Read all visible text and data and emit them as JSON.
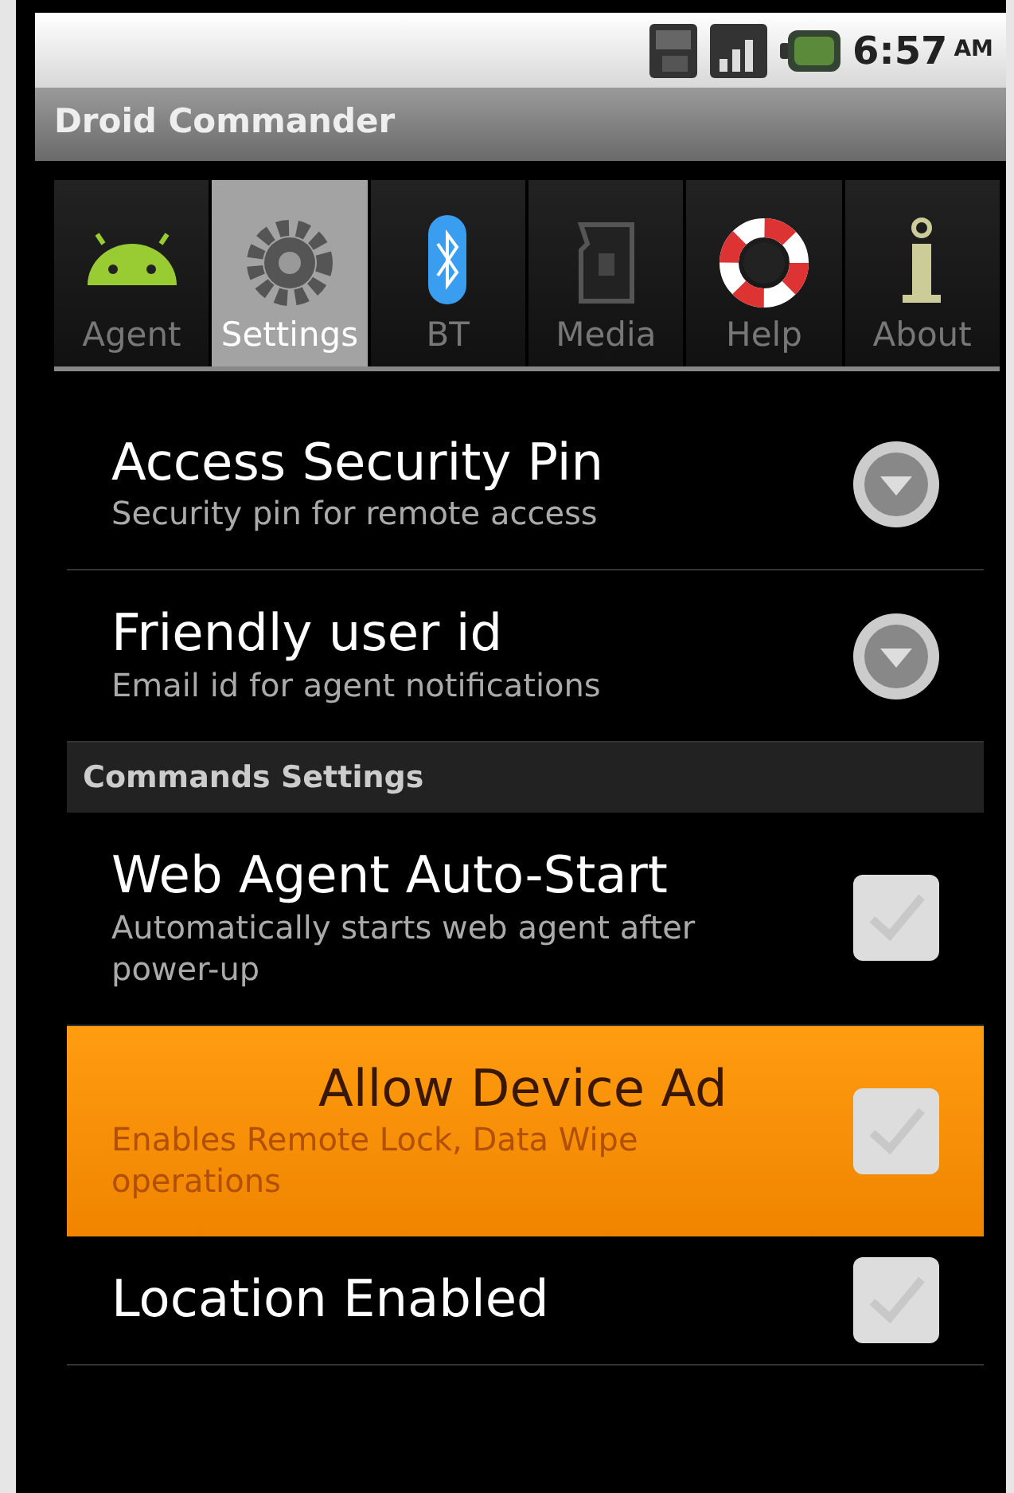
{
  "status_bar": {
    "time": "6:57",
    "ampm": "AM"
  },
  "app_title": "Droid Commander",
  "tabs": [
    {
      "label": "Agent",
      "selected": false
    },
    {
      "label": "Settings",
      "selected": true
    },
    {
      "label": "BT",
      "selected": false
    },
    {
      "label": "Media",
      "selected": false
    },
    {
      "label": "Help",
      "selected": false
    },
    {
      "label": "About",
      "selected": false
    }
  ],
  "preferences": [
    {
      "kind": "dialog",
      "title": "Access Security Pin",
      "summary": "Security pin for remote access",
      "selected": false
    },
    {
      "kind": "dialog",
      "title": "Friendly user id",
      "summary": "Email id for agent notifications",
      "selected": false
    },
    {
      "kind": "header",
      "title": "Commands Settings"
    },
    {
      "kind": "checkbox",
      "title": "Web Agent Auto-Start",
      "summary": "Automatically starts web agent after power-up",
      "checked": false,
      "selected": false
    },
    {
      "kind": "checkbox",
      "title": "Allow Device Ad",
      "summary": "Enables Remote Lock, Data Wipe operations",
      "checked": false,
      "selected": true
    },
    {
      "kind": "checkbox",
      "title": "Location Enabled",
      "checked": false,
      "selected": false
    }
  ]
}
